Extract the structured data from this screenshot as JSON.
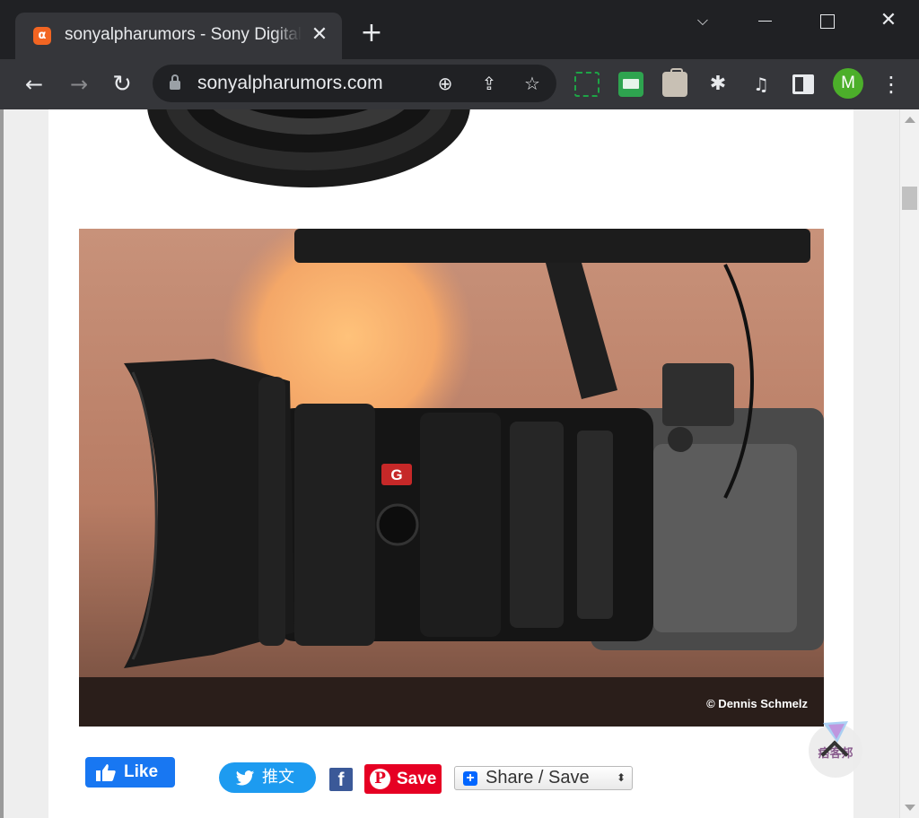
{
  "browser": {
    "tab_title": "sonyalpharumors - Sony Digital Camera",
    "tab_favicon_glyph": "α",
    "close_glyph": "✕",
    "new_tab_glyph": "+",
    "url": "sonyalpharumors.com",
    "profile_initial": "M",
    "window_controls": {
      "dropdown": "⌵",
      "close": "✕"
    },
    "nav": {
      "back": "←",
      "forward": "→",
      "reload": "↻"
    },
    "omnibox_icons": {
      "zoom": "⊕",
      "share": "⇪",
      "star": "☆"
    },
    "toolbar_icons": {
      "puzzle": "✱",
      "media": "♫",
      "menu": "⋮"
    },
    "icons": [
      "screenshot-icon",
      "mail-icon",
      "bag-icon",
      "extensions-icon",
      "media-icon",
      "side-panel-icon"
    ]
  },
  "article": {
    "photo_credit": "© Dennis Schmelz",
    "lens_badge": "G"
  },
  "share_bar": {
    "fb_like_label": "Like",
    "tweet_label": "推文",
    "facebook_glyph": "f",
    "pin_glyph": "P",
    "pinterest_label": "Save",
    "share_save_label": "Share / Save",
    "plus_glyph": "+",
    "updown_glyph": "⬍"
  },
  "scroll_to_top": {
    "label": "痞客邦"
  },
  "colors": {
    "chrome_dark": "#202124",
    "chrome_toolbar": "#35363a",
    "facebook": "#1877f2",
    "twitter": "#1d9bf0",
    "pinterest": "#e60023",
    "avatar": "#4caf2a"
  }
}
